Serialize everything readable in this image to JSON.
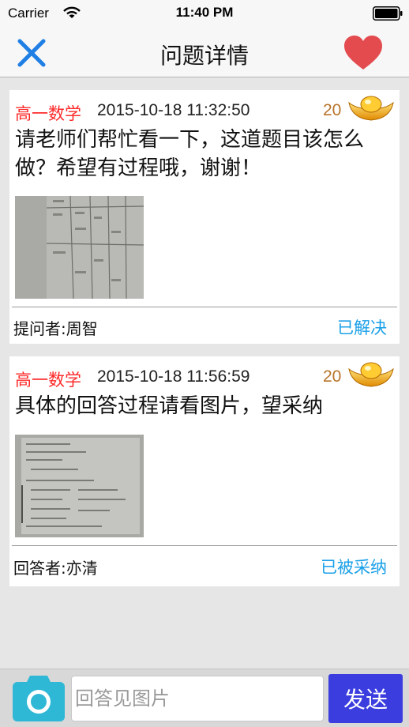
{
  "status_bar": {
    "carrier": "Carrier",
    "time": "11:40 PM",
    "wifi_icon": "wifi-icon",
    "battery_icon": "battery-icon"
  },
  "nav": {
    "title": "问题详情",
    "close_icon": "close-icon",
    "favorite_icon": "heart-icon",
    "accent_color": "#1f7fe5",
    "heart_color": "#e34b4f"
  },
  "question": {
    "subject": "高一数学",
    "time": "2015-10-18 11:32:50",
    "points": "20",
    "text": "请老师们帮忙看一下，这道题目该怎么做？希望有过程哦，谢谢！",
    "person": "提问者:周智",
    "status": "已解决"
  },
  "answer": {
    "subject": "高一数学",
    "time": "2015-10-18 11:56:59",
    "points": "20",
    "text": "具体的回答过程请看图片，望采纳",
    "person": "回答者:亦清",
    "status": "已被采纳"
  },
  "bottom": {
    "input_value": "",
    "input_placeholder": "回答见图片",
    "send_label": "发送",
    "camera_icon": "camera-icon"
  },
  "colors": {
    "subject": "#ff2a2a",
    "status_link": "#1aa0e8",
    "points": "#b8732a",
    "send_button": "#3b3ddf",
    "camera_button": "#2fb8d6"
  }
}
